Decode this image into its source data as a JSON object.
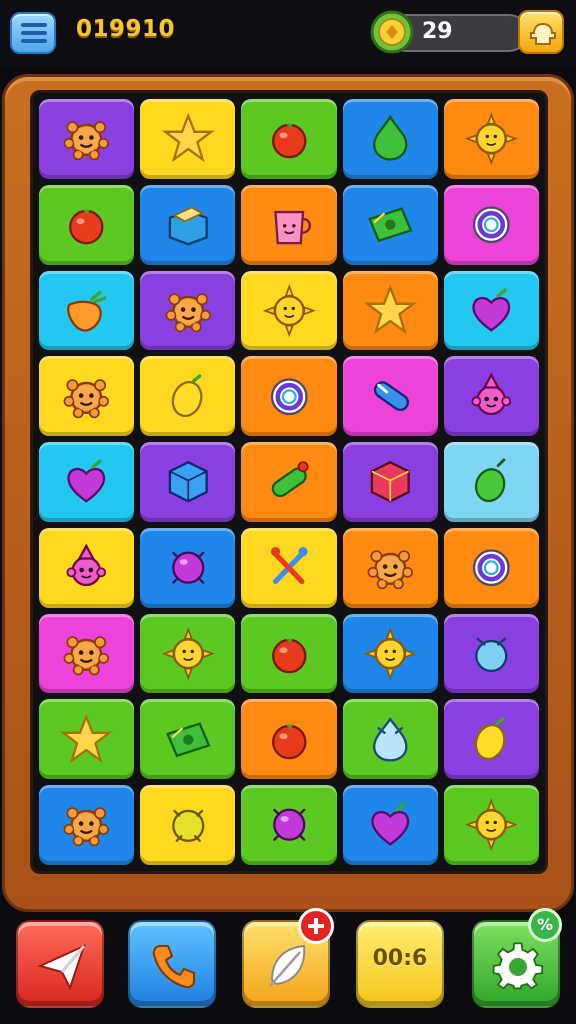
{
  "header": {
    "score": "019910",
    "coins": "29",
    "menu_icon": "hamburger-menu-icon",
    "coin_icon": "coin-icon",
    "shop_icon": "shop-hand-icon"
  },
  "colors": {
    "purple": "#8a3fe0",
    "yellow": "#ffd81f",
    "green": "#5cc922",
    "blue": "#1f86ea",
    "orange": "#ff8a12",
    "magenta": "#ee43d8",
    "cyan": "#23c8f0",
    "lightblue": "#7fd6f4"
  },
  "board": {
    "rows": [
      [
        {
          "color": "purple",
          "item": "sun-face"
        },
        {
          "color": "yellow",
          "item": "star"
        },
        {
          "color": "green",
          "item": "red-ball"
        },
        {
          "color": "blue",
          "item": "green-drop"
        },
        {
          "color": "orange",
          "item": "sun"
        }
      ],
      [
        {
          "color": "green",
          "item": "red-ball"
        },
        {
          "color": "blue",
          "item": "box"
        },
        {
          "color": "orange",
          "item": "cup"
        },
        {
          "color": "blue",
          "item": "cash"
        },
        {
          "color": "magenta",
          "item": "ring"
        }
      ],
      [
        {
          "color": "cyan",
          "item": "orange-fruit"
        },
        {
          "color": "purple",
          "item": "sun-face"
        },
        {
          "color": "yellow",
          "item": "sun"
        },
        {
          "color": "orange",
          "item": "star"
        },
        {
          "color": "cyan",
          "item": "heart"
        }
      ],
      [
        {
          "color": "yellow",
          "item": "sun-face"
        },
        {
          "color": "yellow",
          "item": "lemon"
        },
        {
          "color": "orange",
          "item": "ring"
        },
        {
          "color": "magenta",
          "item": "tube"
        },
        {
          "color": "purple",
          "item": "creature"
        }
      ],
      [
        {
          "color": "cyan",
          "item": "heart"
        },
        {
          "color": "purple",
          "item": "cube"
        },
        {
          "color": "orange",
          "item": "tube-green"
        },
        {
          "color": "purple",
          "item": "cube-red"
        },
        {
          "color": "lightblue",
          "item": "green-fruit"
        }
      ],
      [
        {
          "color": "yellow",
          "item": "creature"
        },
        {
          "color": "blue",
          "item": "purple-ball"
        },
        {
          "color": "yellow",
          "item": "tools"
        },
        {
          "color": "orange",
          "item": "sun-face"
        },
        {
          "color": "orange",
          "item": "ring"
        }
      ],
      [
        {
          "color": "magenta",
          "item": "sun-face"
        },
        {
          "color": "green",
          "item": "sun"
        },
        {
          "color": "green",
          "item": "red-ball"
        },
        {
          "color": "blue",
          "item": "sun"
        },
        {
          "color": "purple",
          "item": "blue-ball"
        }
      ],
      [
        {
          "color": "green",
          "item": "star"
        },
        {
          "color": "green",
          "item": "cash"
        },
        {
          "color": "orange",
          "item": "red-ball"
        },
        {
          "color": "green",
          "item": "blue-drop"
        },
        {
          "color": "purple",
          "item": "lemon"
        }
      ],
      [
        {
          "color": "blue",
          "item": "sun-face"
        },
        {
          "color": "yellow",
          "item": "yellow-ball"
        },
        {
          "color": "green",
          "item": "purple-ball"
        },
        {
          "color": "blue",
          "item": "heart"
        },
        {
          "color": "green",
          "item": "sun"
        }
      ]
    ]
  },
  "toolbar": {
    "send_icon": "paper-plane-icon",
    "phone_icon": "phone-icon",
    "feather_icon": "feather-icon",
    "timer": "00:6",
    "gear_icon": "gear-icon",
    "badge_percent": "%"
  }
}
